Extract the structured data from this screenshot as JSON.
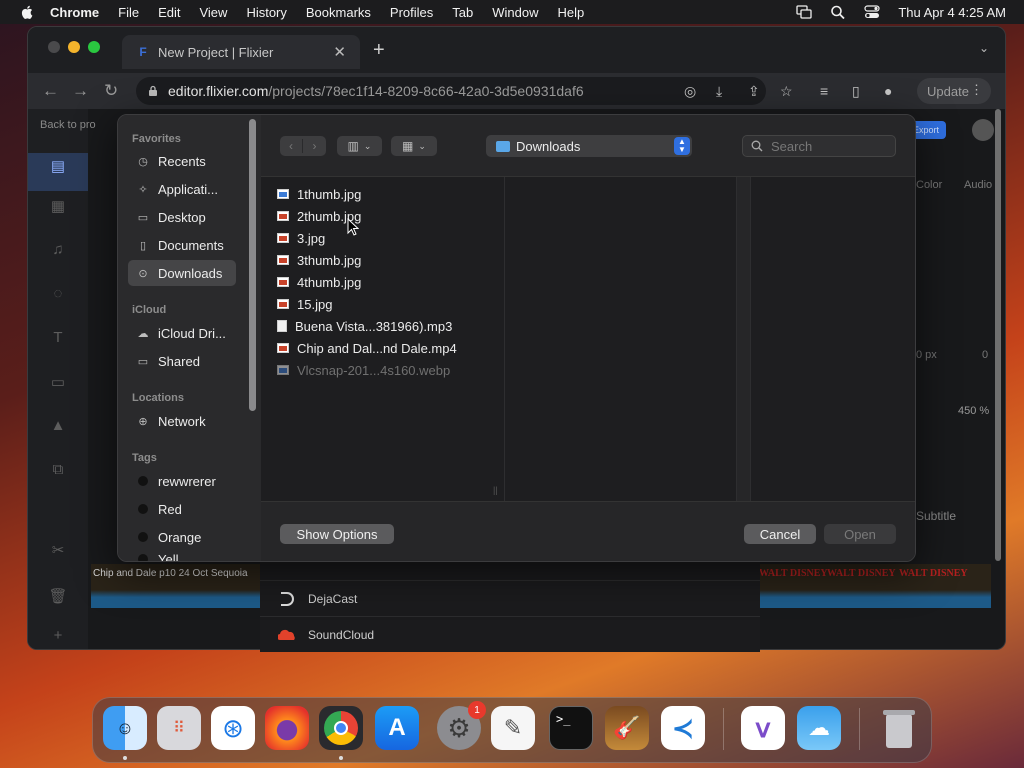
{
  "menubar": {
    "app_name": "Chrome",
    "items": [
      "File",
      "Edit",
      "View",
      "History",
      "Bookmarks",
      "Profiles",
      "Tab",
      "Window",
      "Help"
    ],
    "clock": "Thu Apr 4  4:25 AM"
  },
  "browser": {
    "tab_title": "New Project | Flixier",
    "tab_favicon": "F",
    "url_host": "editor.flixier.com",
    "url_path": "/projects/78ec1f14-8209-8c66-42a0-3d5e0931daf6",
    "update_label": "Update",
    "back_to_projects": "Back to pro"
  },
  "dialog": {
    "sidebar": {
      "favorites_header": "Favorites",
      "favorites": [
        "Recents",
        "Applicati...",
        "Desktop",
        "Documents",
        "Downloads"
      ],
      "icloud_header": "iCloud",
      "icloud": [
        "iCloud Dri...",
        "Shared"
      ],
      "locations_header": "Locations",
      "locations": [
        "Network"
      ],
      "tags_header": "Tags",
      "tags": [
        "rewwrerer",
        "Red",
        "Orange",
        "Yell"
      ],
      "tag_colors": [
        "#1a1a1a",
        "#1a1a1a",
        "#1a1a1a",
        "#1a1a1a"
      ]
    },
    "location": "Downloads",
    "search_placeholder": "Search",
    "files": [
      "1thumb.jpg",
      "2thumb.jpg",
      "3.jpg",
      "3thumb.jpg",
      "4thumb.jpg",
      "15.jpg",
      "Buena Vista...381966).mp3",
      "Chip and Dal...nd Dale.mp4",
      "Vlcsnap-201...4s160.webp"
    ],
    "show_options": "Show Options",
    "cancel": "Cancel",
    "open": "Open"
  },
  "background_page": {
    "source_items": [
      "DejaCast",
      "SoundCloud"
    ],
    "timeline_clip": "Chip and Dale p10 24 Oct Sequoia",
    "brand_text": "WALT DISNEY",
    "right_panel": [
      "Color",
      "Audio",
      "0 px",
      "0",
      "450 %",
      "Subtitle"
    ]
  },
  "dock": {
    "apps": [
      "Finder",
      "Launchpad",
      "Safari",
      "Firefox",
      "Chrome",
      "App Store",
      "System Settings",
      "TextEdit",
      "Terminal",
      "Instruments",
      "Visual Studio Code",
      "Visual Studio",
      "Weather",
      "Trash"
    ],
    "settings_badge": "1"
  },
  "colors": {
    "accent": "#2f6fe0",
    "dialog_bg": "#1f1f21",
    "sidebar_bg": "#2a2a2c"
  }
}
